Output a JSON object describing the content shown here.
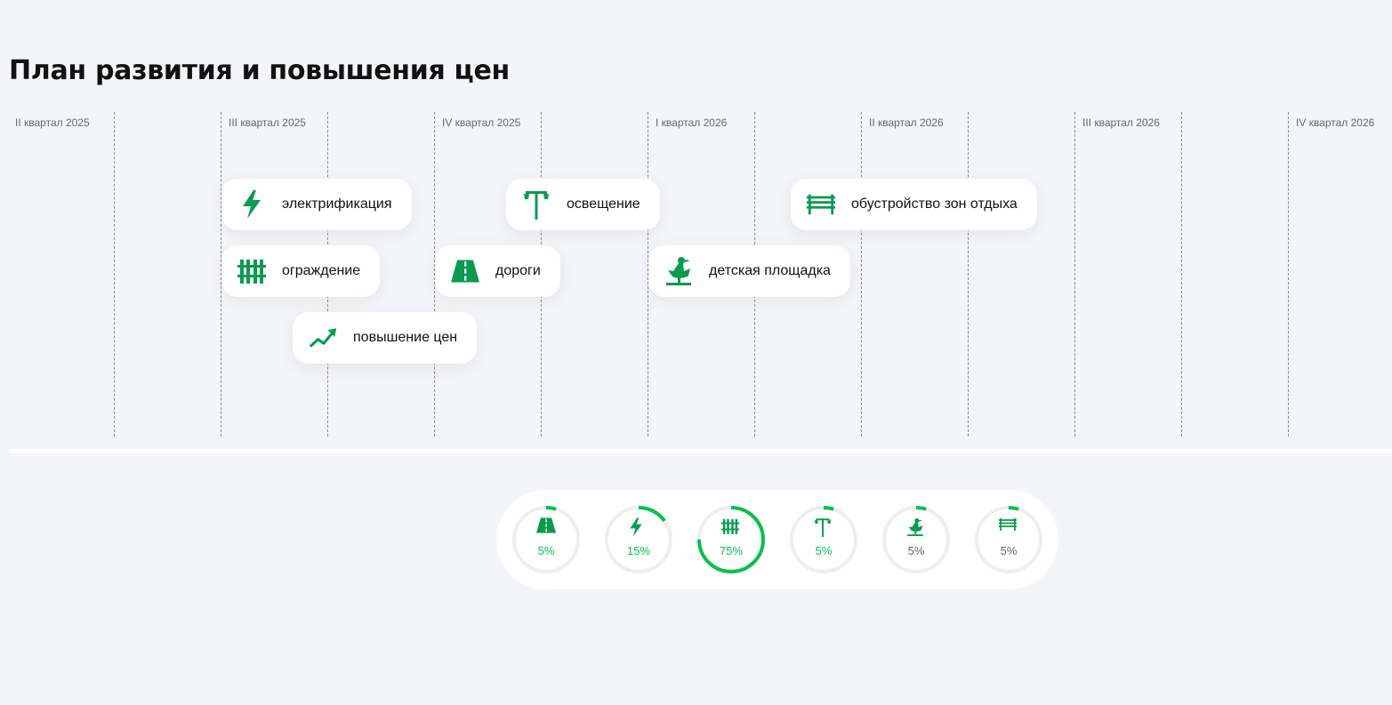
{
  "page": {
    "title": "План развития и повышения цен"
  },
  "colors": {
    "accent": "#0a9a50",
    "ring": "#09c04c",
    "ring_track": "#eeeeee",
    "background": "#f4f5f8"
  },
  "timeline": {
    "quarters": [
      "II квартал 2025",
      "III квартал 2025",
      "IV квартал 2025",
      "I квартал 2026",
      "II квартал 2026",
      "III квартал 2026",
      "IV квартал 2026"
    ],
    "tasks": [
      {
        "label": "электрификация",
        "icon": "lightning-icon"
      },
      {
        "label": "ограждение",
        "icon": "fence-icon"
      },
      {
        "label": "повышение цен",
        "icon": "trend-up-icon"
      },
      {
        "label": "дороги",
        "icon": "road-icon"
      },
      {
        "label": "освещение",
        "icon": "streetlight-icon"
      },
      {
        "label": "детская площадка",
        "icon": "rocking-duck-icon"
      },
      {
        "label": "обустройство зон отдыха",
        "icon": "bench-icon"
      }
    ]
  },
  "progress": [
    {
      "icon": "road-icon",
      "percent": 5,
      "label": "5%",
      "highlight": true
    },
    {
      "icon": "lightning-icon",
      "percent": 15,
      "label": "15%",
      "highlight": true
    },
    {
      "icon": "fence-icon",
      "percent": 75,
      "label": "75%",
      "highlight": true
    },
    {
      "icon": "streetlight-icon",
      "percent": 5,
      "label": "5%",
      "highlight": true
    },
    {
      "icon": "rocking-duck-icon",
      "percent": 5,
      "label": "5%",
      "highlight": false
    },
    {
      "icon": "bench-icon",
      "percent": 5,
      "label": "5%",
      "highlight": false
    }
  ]
}
